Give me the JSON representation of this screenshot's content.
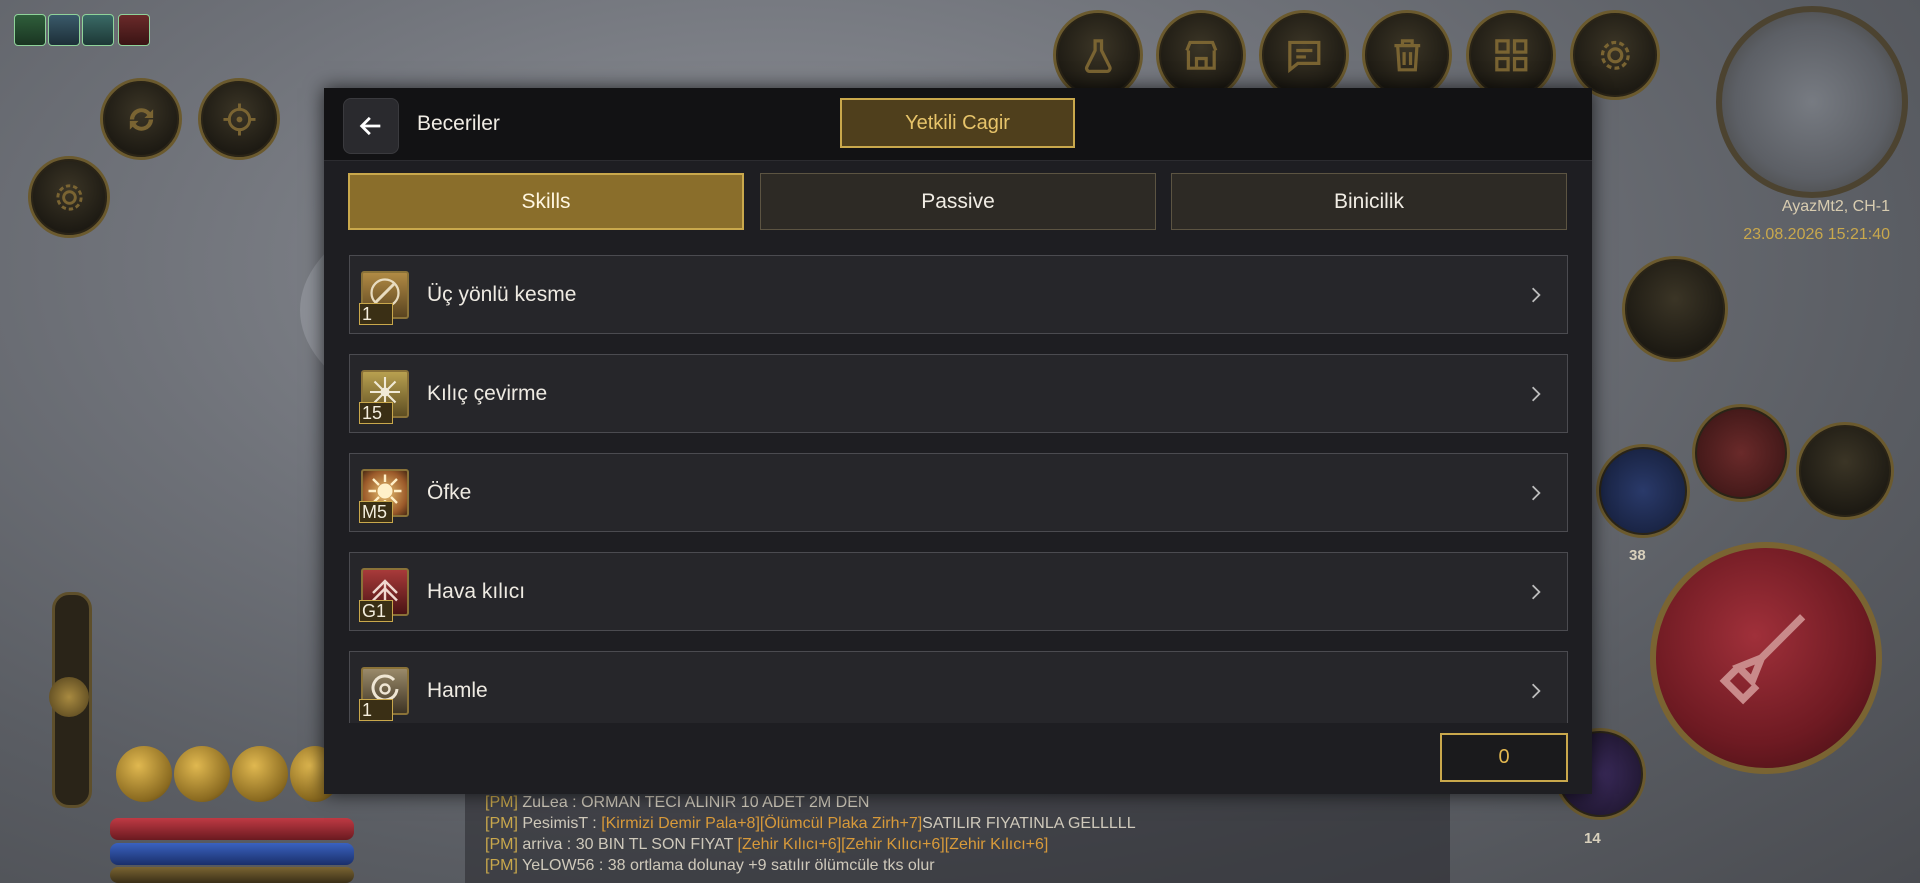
{
  "hud": {
    "map_name": "AyazMt2, CH-1",
    "datetime": "23.08.2026 15:21:40",
    "counter_a": "38",
    "counter_b": "14",
    "top_buttons": [
      "flask-icon",
      "shop-icon",
      "chat-icon",
      "trash-icon",
      "grid-icon",
      "gear-icon"
    ]
  },
  "dialog": {
    "title": "Beceriler",
    "call_button": "Yetkili Cagir",
    "tabs": [
      {
        "label": "Skills",
        "active": true
      },
      {
        "label": "Passive",
        "active": false
      },
      {
        "label": "Binicilik",
        "active": false
      }
    ],
    "skills": [
      {
        "name": "Üç yönlü kesme",
        "level": "1",
        "color": "#8a6b2e"
      },
      {
        "name": "Kılıç çevirme",
        "level": "15",
        "color": "#8c7a3a"
      },
      {
        "name": "Öfke",
        "level": "M5",
        "color": "#9b5a2a"
      },
      {
        "name": "Hava kılıcı",
        "level": "G1",
        "color": "#8a2a2a"
      },
      {
        "name": "Hamle",
        "level": "1",
        "color": "#7a6a4a"
      }
    ],
    "points": "0"
  },
  "chat": [
    {
      "tag": "[PM]",
      "sender": "ZuLea :",
      "text": "ORMAN TECI ALINIR 10 ADET 2M DEN",
      "items": ""
    },
    {
      "tag": "[PM]",
      "sender": "PesimisT :",
      "text": "SATILIR FIYATINLA GELLLLL",
      "items": "[Kirmizi Demir Pala+8][Ölümcül Plaka Zirh+7]"
    },
    {
      "tag": "[PM]",
      "sender": "arriva :",
      "text": "30 BIN TL SON FIYAT",
      "items": "[Zehir Kılıcı+6][Zehir Kılıcı+6][Zehir Kılıcı+6]"
    },
    {
      "tag": "[PM]",
      "sender": "YeLOW56 :",
      "text": "38 ortlama dolunay +9 satılır ölümcüle tks olur",
      "items": ""
    }
  ],
  "colors": {
    "accent": "#c9a84c",
    "tab_active": "#8a6e2b",
    "panel": "#1e1e22"
  }
}
